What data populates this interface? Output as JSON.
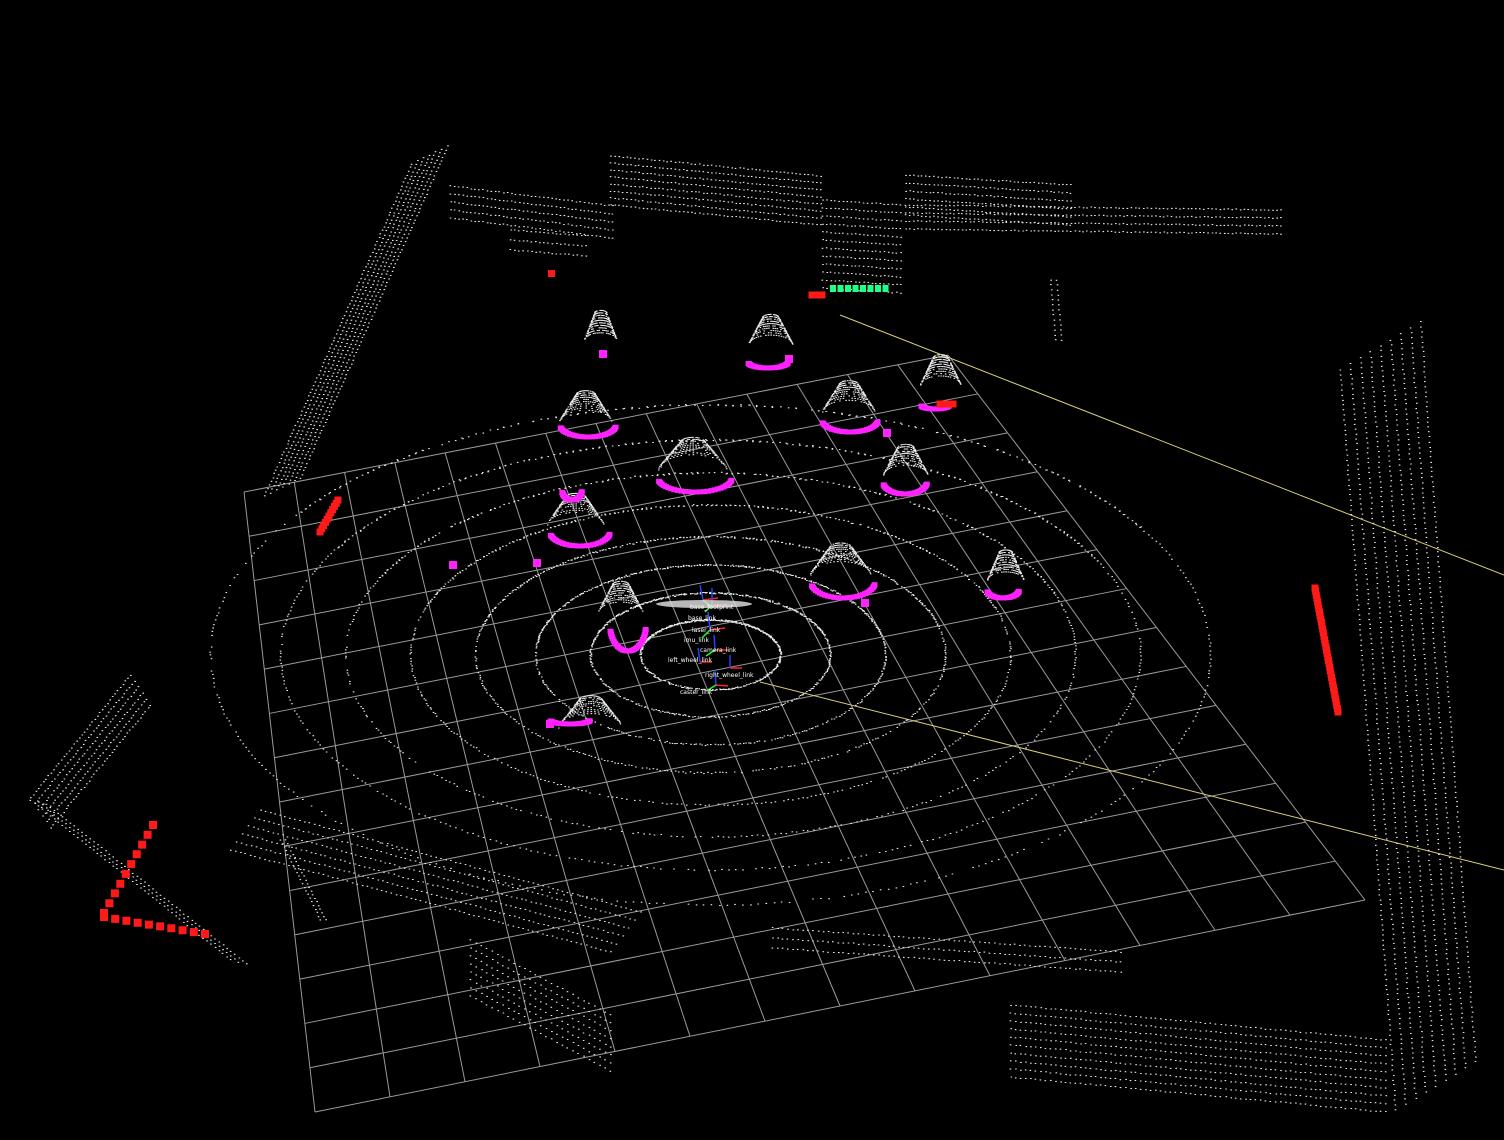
{
  "view": {
    "background_color": "#000000",
    "grid_color": "#9a9a9a",
    "laser_scan_color": "#e8e8e8",
    "odom_path_color": "#d8d07a",
    "obstacle_marker_color": "#ff1a1a",
    "inflation_marker_color": "#ff22ff",
    "goal_marker_color": "#22ff88"
  },
  "robot": {
    "frame_labels": [
      "base_footprint",
      "base_link",
      "laser_link",
      "imu_link",
      "camera_link",
      "left_wheel_link",
      "right_wheel_link",
      "caster_link"
    ],
    "axis_colors": {
      "x": "#ff2222",
      "y": "#22ff22",
      "z": "#2244ff"
    }
  }
}
